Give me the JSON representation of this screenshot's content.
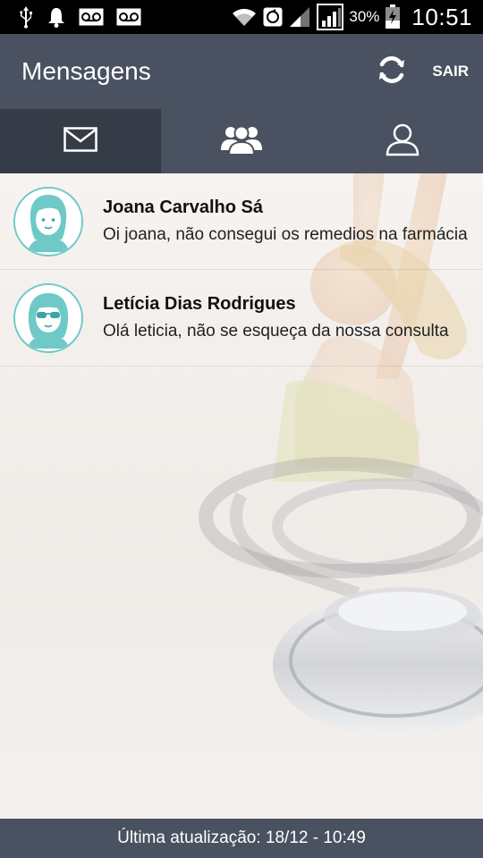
{
  "status_bar": {
    "battery_percent": "30%",
    "time": "10:51",
    "icons": [
      "usb-icon",
      "notification-bell-icon",
      "voicemail-icon",
      "voicemail-icon",
      "wifi-icon",
      "sync-icon",
      "signal-icon",
      "signal-icon",
      "battery-icon"
    ]
  },
  "header": {
    "title": "Mensagens",
    "refresh_icon": "refresh-icon",
    "logout_label": "SAIR"
  },
  "tabs": [
    {
      "icon": "envelope-icon",
      "active": true
    },
    {
      "icon": "group-icon",
      "active": false
    },
    {
      "icon": "user-icon",
      "active": false
    }
  ],
  "messages": [
    {
      "name": "Joana Carvalho Sá",
      "preview": "Oi joana, não consegui os remedios na farmácia",
      "avatar_icon": "woman-avatar-icon"
    },
    {
      "name": "Letícia Dias Rodrigues",
      "preview": "Olá leticia, não se esqueça da nossa consulta",
      "avatar_icon": "woman-sunglasses-avatar-icon"
    }
  ],
  "footer": {
    "last_update": "Última atualização: 18/12 - 10:49"
  },
  "colors": {
    "header_bg": "#4a5160",
    "active_tab_bg": "#363c47",
    "avatar_accent": "#6fc9c6",
    "status_bar_bg": "#000000"
  }
}
